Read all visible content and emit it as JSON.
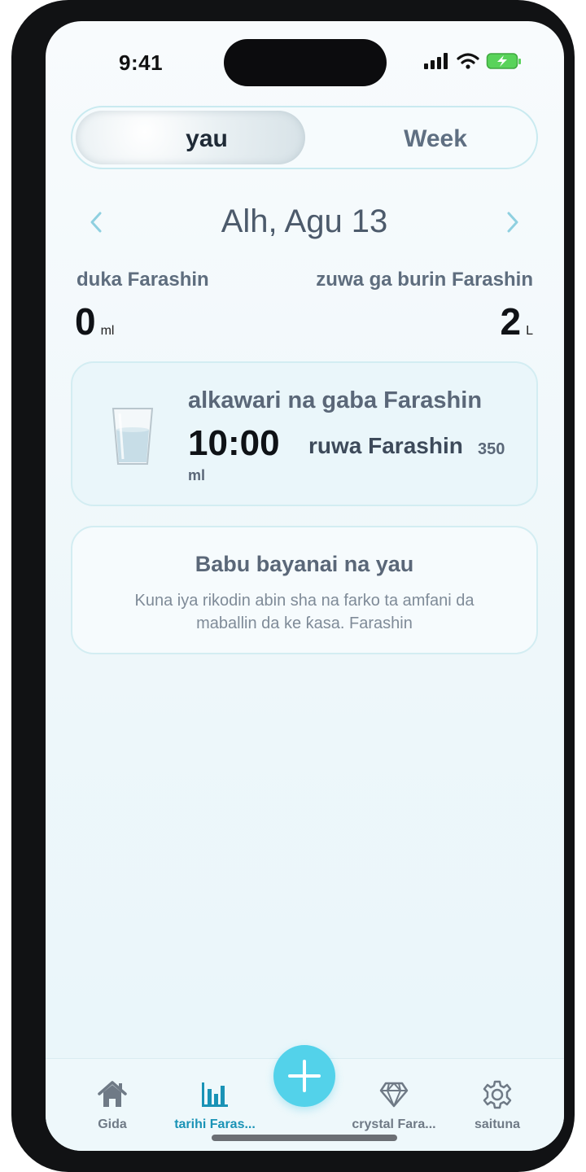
{
  "status_bar": {
    "time": "9:41"
  },
  "segmented": {
    "day_label": "yau",
    "week_label": "Week",
    "selected": "yau"
  },
  "date_nav": {
    "date": "Alh, Agu 13"
  },
  "stats": {
    "left_label": "duka Farashin",
    "left_value": "0",
    "left_unit": "ml",
    "right_label": "zuwa ga burin Farashin",
    "right_value": "2",
    "right_unit": "L"
  },
  "reminder_card": {
    "title": "alkawari na gaba Farashin",
    "time": "10:00",
    "amount_label": "ruwa Farashin",
    "amount": "350",
    "amount_unit": "ml",
    "icon": "water-glass-icon"
  },
  "empty_state": {
    "title": "Babu bayanai na yau",
    "message": "Kuna iya rikodin abin sha na farko ta amfani da maballin da ke ƙasa. Farashin"
  },
  "tab_bar": {
    "items": [
      {
        "label": "Gida",
        "icon": "home-icon",
        "active": false
      },
      {
        "label": "tarihi Faras...",
        "icon": "bar-chart-icon",
        "active": true
      },
      {
        "label": "crystal Fara...",
        "icon": "diamond-icon",
        "active": false
      },
      {
        "label": "saituna",
        "icon": "gear-icon",
        "active": false
      }
    ],
    "fab_icon": "plus-icon"
  },
  "colors": {
    "accent": "#53d2ea",
    "active_tab": "#1a93b6",
    "card_border": "#d3edf2"
  }
}
